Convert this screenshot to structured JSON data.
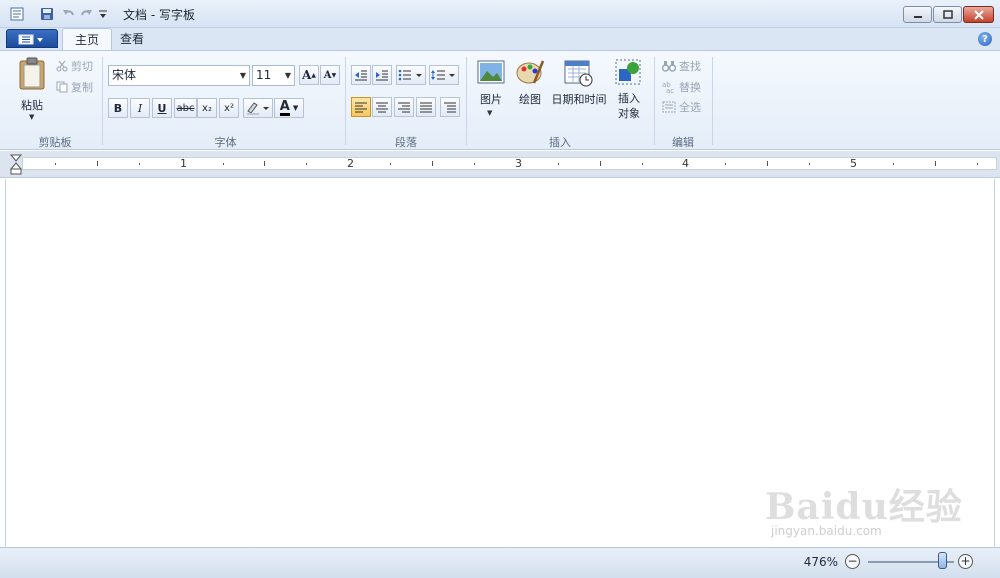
{
  "window": {
    "title": "文档 - 写字板"
  },
  "tabs": [
    {
      "label": "主页"
    },
    {
      "label": "查看"
    }
  ],
  "clipboard": {
    "paste": "粘贴",
    "cut": "剪切",
    "copy": "复制",
    "group": "剪贴板"
  },
  "font": {
    "family": "宋体",
    "size": "11",
    "group": "字体",
    "grow": "A",
    "shrink": "A",
    "bold": "B",
    "italic": "I",
    "underline": "U",
    "strike": "abc",
    "sub": "x₂",
    "sup": "x²",
    "color": "A"
  },
  "paragraph": {
    "group": "段落"
  },
  "insert": {
    "picture": "图片",
    "paint": "绘图",
    "datetime": "日期和时间",
    "object_line1": "插入",
    "object_line2": "对象",
    "group": "插入"
  },
  "edit": {
    "find": "查找",
    "replace": "替换",
    "select_all": "全选",
    "group": "编辑"
  },
  "ruler": {
    "numbers": [
      "1",
      "2",
      "3",
      "4",
      "5"
    ]
  },
  "status": {
    "zoom": "476%",
    "zoom_out": "−",
    "zoom_in": "+",
    "zoom_fraction": 0.87
  },
  "watermark": {
    "brand": "Baidu经验",
    "url": "jingyan.baidu.com"
  },
  "colors": {
    "accent": "#1d4c9c",
    "ribbon": "#e4edf8",
    "highlight": "#f7c75c"
  }
}
